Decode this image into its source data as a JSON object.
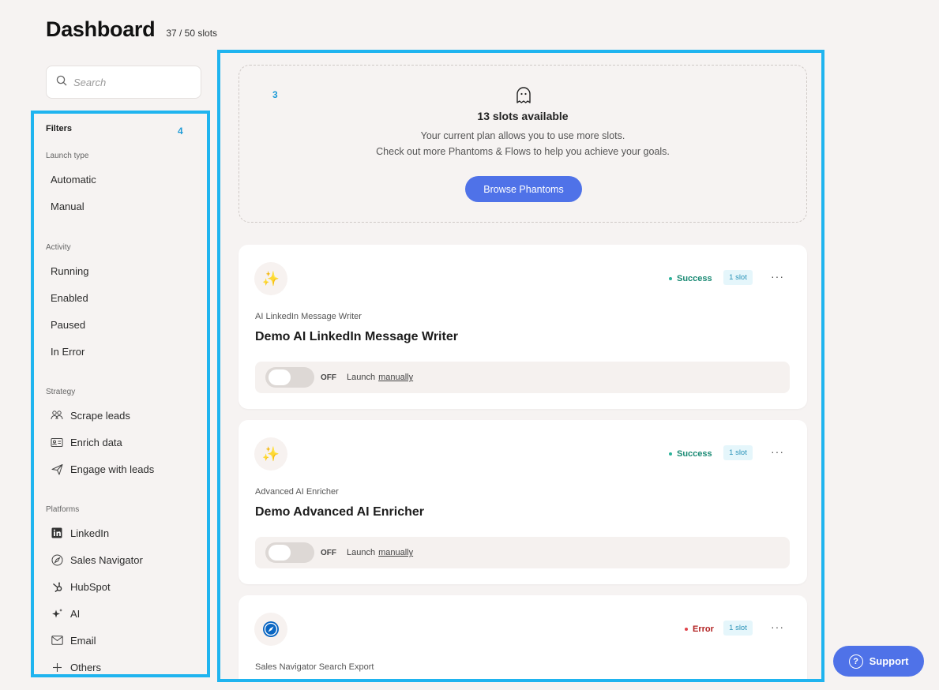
{
  "header": {
    "title": "Dashboard",
    "slots": "37 / 50 slots"
  },
  "search": {
    "placeholder": "Search"
  },
  "annotations": {
    "filters_num": "4",
    "main_num": "3",
    "color": "#1fb4ef"
  },
  "filters": {
    "title": "Filters",
    "launch_type": {
      "label": "Launch type",
      "items": [
        "Automatic",
        "Manual"
      ]
    },
    "activity": {
      "label": "Activity",
      "items": [
        "Running",
        "Enabled",
        "Paused",
        "In Error"
      ]
    },
    "strategy": {
      "label": "Strategy",
      "items": [
        {
          "label": "Scrape leads",
          "icon": "users-icon"
        },
        {
          "label": "Enrich data",
          "icon": "id-card-icon"
        },
        {
          "label": "Engage with leads",
          "icon": "paper-plane-icon"
        }
      ]
    },
    "platforms": {
      "label": "Platforms",
      "items": [
        {
          "label": "LinkedIn",
          "icon": "linkedin-icon"
        },
        {
          "label": "Sales Navigator",
          "icon": "compass-icon"
        },
        {
          "label": "HubSpot",
          "icon": "hubspot-icon"
        },
        {
          "label": "AI",
          "icon": "sparkle-icon"
        },
        {
          "label": "Email",
          "icon": "envelope-icon"
        },
        {
          "label": "Others",
          "icon": "plus-icon"
        }
      ]
    }
  },
  "slots_box": {
    "title": "13 slots available",
    "line1": "Your current plan allows you to use more slots.",
    "line2": "Check out more Phantoms & Flows to help you achieve your goals.",
    "button": "Browse Phantoms"
  },
  "cards": [
    {
      "type": "AI LinkedIn Message Writer",
      "name": "Demo AI LinkedIn Message Writer",
      "status": "Success",
      "status_color": "#1a8a74",
      "slot": "1 slot",
      "toggle": "OFF",
      "launch": "Launch",
      "launch_link": "manually",
      "icon": "sparkles-icon"
    },
    {
      "type": "Advanced AI Enricher",
      "name": "Demo Advanced AI Enricher",
      "status": "Success",
      "status_color": "#1a8a74",
      "slot": "1 slot",
      "toggle": "OFF",
      "launch": "Launch",
      "launch_link": "manually",
      "icon": "sparkles-icon"
    },
    {
      "type": "Sales Navigator Search Export",
      "name": "",
      "status": "Error",
      "status_color": "#b22222",
      "slot": "1 slot",
      "icon": "compass-icon"
    }
  ],
  "more_label": "···",
  "support": {
    "label": "Support"
  }
}
